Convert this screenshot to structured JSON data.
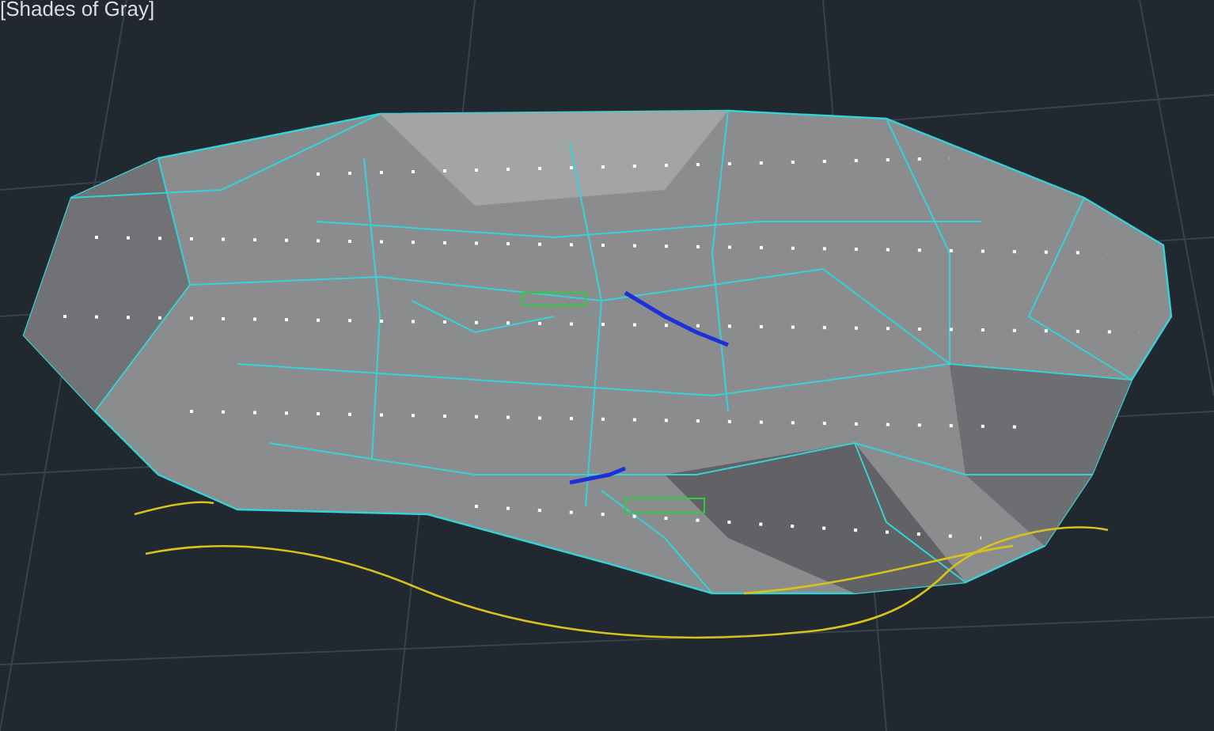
{
  "viewport": {
    "visual_style_label": "[Shades of Gray]"
  }
}
